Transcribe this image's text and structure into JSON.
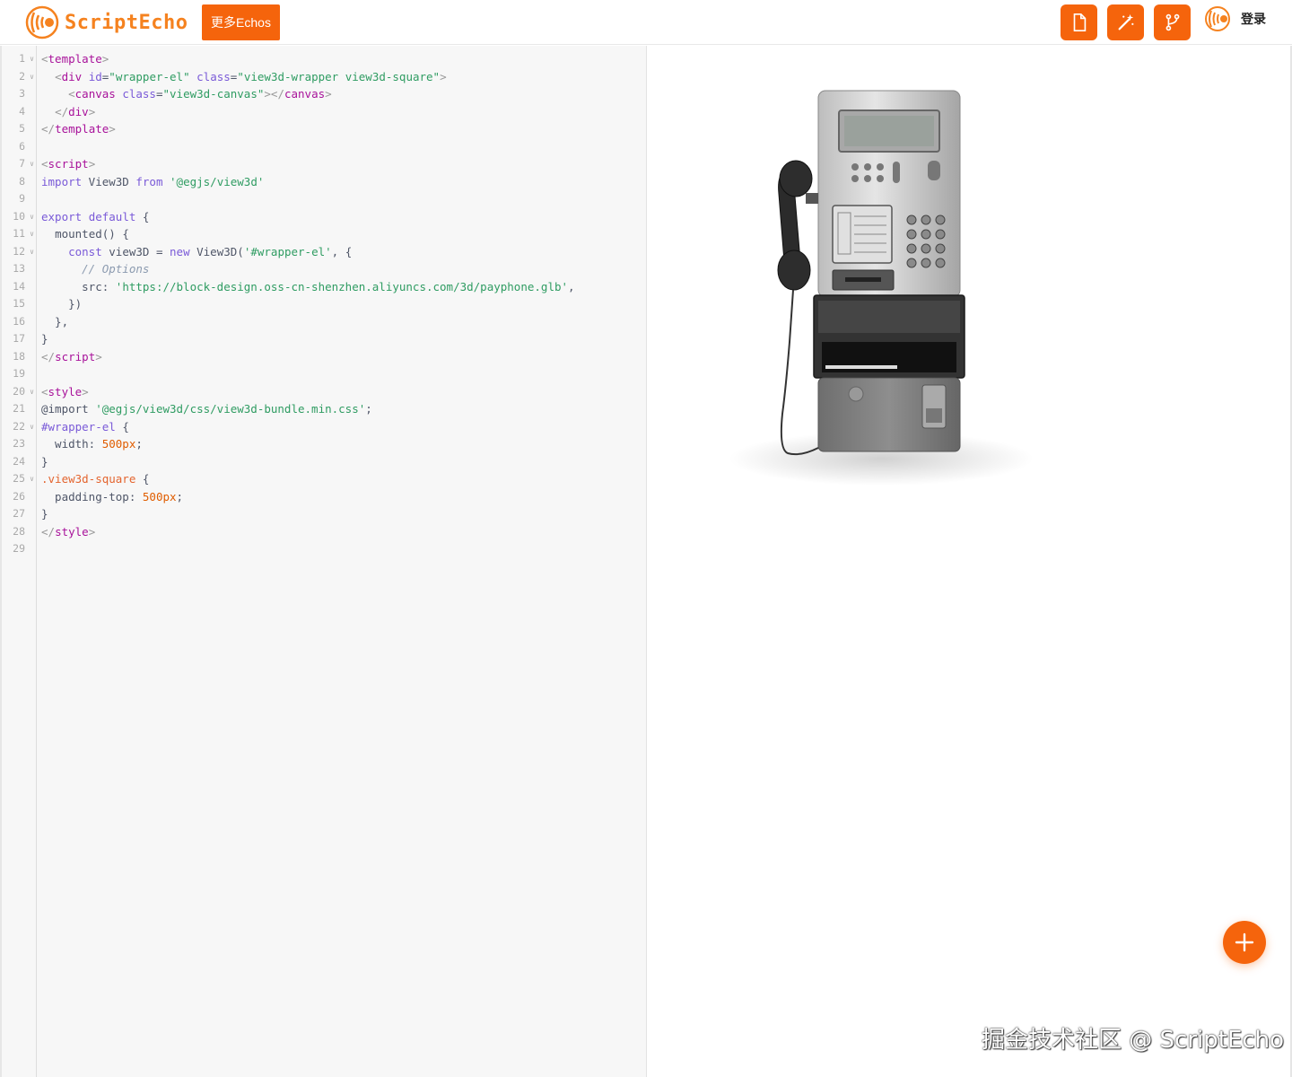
{
  "header": {
    "logo_text": "ScriptEcho",
    "more_button": "更多Echos",
    "tools": [
      "file-icon",
      "magic-wand-icon",
      "branch-icon"
    ],
    "login": "登录"
  },
  "editor": {
    "line_numbers": [
      "1",
      "2",
      "3",
      "4",
      "5",
      "6",
      "7",
      "8",
      "9",
      "10",
      "11",
      "12",
      "13",
      "14",
      "15",
      "16",
      "17",
      "18",
      "19",
      "20",
      "21",
      "22",
      "23",
      "24",
      "25",
      "26",
      "27",
      "28",
      "29"
    ],
    "folded_lines": [
      1,
      2,
      7,
      10,
      11,
      12,
      20,
      22,
      25
    ],
    "lines": [
      [
        [
          "punc",
          "<"
        ],
        [
          "tag",
          "template"
        ],
        [
          "punc",
          ">"
        ]
      ],
      [
        [
          "plain",
          "  "
        ],
        [
          "punc",
          "<"
        ],
        [
          "tag",
          "div"
        ],
        [
          "plain",
          " "
        ],
        [
          "attr",
          "id"
        ],
        [
          "plain",
          "="
        ],
        [
          "str",
          "\"wrapper-el\""
        ],
        [
          "plain",
          " "
        ],
        [
          "attr",
          "class"
        ],
        [
          "plain",
          "="
        ],
        [
          "str",
          "\"view3d-wrapper view3d-square\""
        ],
        [
          "punc",
          ">"
        ]
      ],
      [
        [
          "plain",
          "    "
        ],
        [
          "punc",
          "<"
        ],
        [
          "tag",
          "canvas"
        ],
        [
          "plain",
          " "
        ],
        [
          "attr",
          "class"
        ],
        [
          "plain",
          "="
        ],
        [
          "str",
          "\"view3d-canvas\""
        ],
        [
          "punc",
          "></"
        ],
        [
          "tag",
          "canvas"
        ],
        [
          "punc",
          ">"
        ]
      ],
      [
        [
          "plain",
          "  "
        ],
        [
          "punc",
          "</"
        ],
        [
          "tag",
          "div"
        ],
        [
          "punc",
          ">"
        ]
      ],
      [
        [
          "punc",
          "</"
        ],
        [
          "tag",
          "template"
        ],
        [
          "punc",
          ">"
        ]
      ],
      [],
      [
        [
          "punc",
          "<"
        ],
        [
          "tag",
          "script"
        ],
        [
          "punc",
          ">"
        ]
      ],
      [
        [
          "kw",
          "import"
        ],
        [
          "plain",
          " View3D "
        ],
        [
          "kw",
          "from"
        ],
        [
          "plain",
          " "
        ],
        [
          "str",
          "'@egjs/view3d'"
        ]
      ],
      [],
      [
        [
          "kw",
          "export"
        ],
        [
          "plain",
          " "
        ],
        [
          "kw",
          "default"
        ],
        [
          "plain",
          " {"
        ]
      ],
      [
        [
          "plain",
          "  "
        ],
        [
          "plain",
          "mounted() {"
        ]
      ],
      [
        [
          "plain",
          "    "
        ],
        [
          "kw",
          "const"
        ],
        [
          "plain",
          " view3D = "
        ],
        [
          "kw",
          "new"
        ],
        [
          "plain",
          " View3D("
        ],
        [
          "str",
          "'#wrapper-el'"
        ],
        [
          "plain",
          ", {"
        ]
      ],
      [
        [
          "plain",
          "      "
        ],
        [
          "com",
          "// Options"
        ]
      ],
      [
        [
          "plain",
          "      src: "
        ],
        [
          "str",
          "'https://block-design.oss-cn-shenzhen.aliyuncs.com/3d/payphone.glb'"
        ],
        [
          "plain",
          ","
        ]
      ],
      [
        [
          "plain",
          "    })"
        ]
      ],
      [
        [
          "plain",
          "  },"
        ]
      ],
      [
        [
          "plain",
          "}"
        ]
      ],
      [
        [
          "punc",
          "</"
        ],
        [
          "tag",
          "script"
        ],
        [
          "punc",
          ">"
        ]
      ],
      [],
      [
        [
          "punc",
          "<"
        ],
        [
          "tag",
          "style"
        ],
        [
          "punc",
          ">"
        ]
      ],
      [
        [
          "plain",
          "@import "
        ],
        [
          "str",
          "'@egjs/view3d/css/view3d-bundle.min.css'"
        ],
        [
          "plain",
          ";"
        ]
      ],
      [
        [
          "sel",
          "#wrapper-el"
        ],
        [
          "plain",
          " {"
        ]
      ],
      [
        [
          "plain",
          "  width: "
        ],
        [
          "num",
          "500px"
        ],
        [
          "plain",
          ";"
        ]
      ],
      [
        [
          "plain",
          "}"
        ]
      ],
      [
        [
          "cls",
          ".view3d-square"
        ],
        [
          "plain",
          " {"
        ]
      ],
      [
        [
          "plain",
          "  padding-top: "
        ],
        [
          "num",
          "500px"
        ],
        [
          "plain",
          ";"
        ]
      ],
      [
        [
          "plain",
          "}"
        ]
      ],
      [
        [
          "punc",
          "</"
        ],
        [
          "tag",
          "style"
        ],
        [
          "punc",
          ">"
        ]
      ],
      []
    ]
  },
  "preview": {
    "model": "payphone",
    "fab_icon": "plus-icon"
  },
  "watermark": "掘金技术社区 @ ScriptEcho",
  "colors": {
    "accent": "#f5640c",
    "logo": "#f5821f"
  }
}
